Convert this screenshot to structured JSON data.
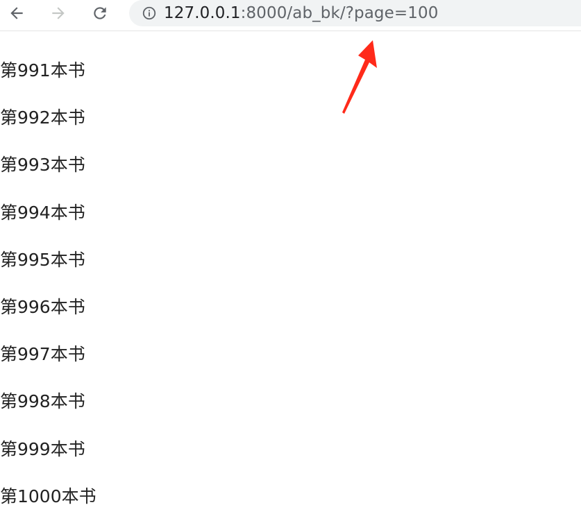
{
  "browser": {
    "back_icon": "arrow-left-icon",
    "forward_icon": "arrow-right-icon",
    "reload_icon": "reload-icon",
    "site_info_icon": "info-circle-icon",
    "url_host": "127.0.0.1",
    "url_path": ":8000/ab_bk/?page=100"
  },
  "annotation": {
    "icon": "red-arrow-icon",
    "color": "#ff2a1a"
  },
  "books": [
    {
      "label": "第991本书"
    },
    {
      "label": "第992本书"
    },
    {
      "label": "第993本书"
    },
    {
      "label": "第994本书"
    },
    {
      "label": "第995本书"
    },
    {
      "label": "第996本书"
    },
    {
      "label": "第997本书"
    },
    {
      "label": "第998本书"
    },
    {
      "label": "第999本书"
    },
    {
      "label": "第1000本书"
    }
  ]
}
